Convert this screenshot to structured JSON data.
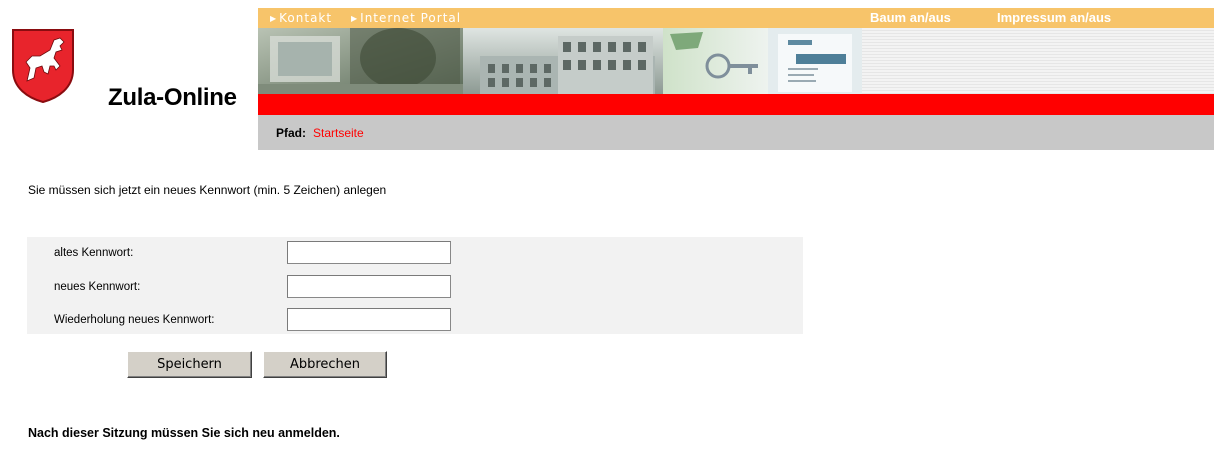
{
  "app": {
    "title": "Zula-Online"
  },
  "topnav": {
    "links": [
      "Kontakt",
      "Internet Portal"
    ],
    "right_links": [
      "Baum an/aus",
      "Impressum an/aus"
    ]
  },
  "breadcrumb": {
    "label": "Pfad:",
    "current": "Startseite"
  },
  "form": {
    "instruction": "Sie müssen sich jetzt ein neues Kennwort (min. 5 Zeichen) anlegen",
    "fields": [
      {
        "label": "altes Kennwort:",
        "value": ""
      },
      {
        "label": "neues Kennwort:",
        "value": ""
      },
      {
        "label": "Wiederholung neues Kennwort:",
        "value": ""
      }
    ],
    "save_label": "Speichern",
    "cancel_label": "Abbrechen"
  },
  "footer": {
    "note": "Nach dieser Sitzung müssen Sie sich neu anmelden."
  },
  "colors": {
    "topbar": "#f7c46a",
    "redbar": "#ff0000",
    "pathbar": "#c8c8c8",
    "form_panel": "#f2f2f2",
    "crest_red": "#e8242c",
    "link_red": "#ff0000"
  }
}
